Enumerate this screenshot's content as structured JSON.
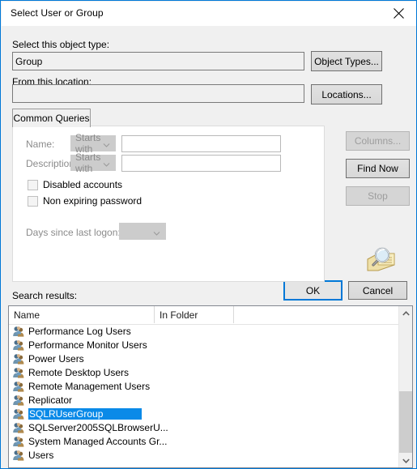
{
  "window": {
    "title": "Select User or Group",
    "close_icon": "close-icon"
  },
  "object_type": {
    "label": "Select this object type:",
    "value": "Group",
    "button": "Object Types..."
  },
  "location": {
    "label": "From this location:",
    "value": "",
    "button": "Locations..."
  },
  "tabs": [
    {
      "label": "Common Queries",
      "active": true
    }
  ],
  "query": {
    "name_label": "Name:",
    "name_operator": "Starts with",
    "name_value": "",
    "description_label": "Description:",
    "description_operator": "Starts with",
    "description_value": "",
    "disabled_accounts_label": "Disabled accounts",
    "disabled_accounts_checked": false,
    "non_expiring_password_label": "Non expiring password",
    "non_expiring_password_checked": false,
    "days_since_logon_label": "Days since last logon:",
    "days_since_logon_value": ""
  },
  "side_buttons": {
    "columns": "Columns...",
    "find_now": "Find Now",
    "stop": "Stop"
  },
  "decoration": {
    "magnifier_icon": "magnifier-folder-icon"
  },
  "dialog_buttons": {
    "ok": "OK",
    "cancel": "Cancel"
  },
  "results": {
    "label": "Search results:",
    "columns": [
      "Name",
      "In Folder"
    ],
    "rows": [
      {
        "name": "Performance Log Users",
        "folder": "",
        "selected": false
      },
      {
        "name": "Performance Monitor Users",
        "folder": "",
        "selected": false
      },
      {
        "name": "Power Users",
        "folder": "",
        "selected": false
      },
      {
        "name": "Remote Desktop Users",
        "folder": "",
        "selected": false
      },
      {
        "name": "Remote Management Users",
        "folder": "",
        "selected": false
      },
      {
        "name": "Replicator",
        "folder": "",
        "selected": false
      },
      {
        "name": "SQLRUserGroup",
        "folder": "",
        "selected": true
      },
      {
        "name": "SQLServer2005SQLBrowserU...",
        "folder": "",
        "selected": false
      },
      {
        "name": "System Managed Accounts Gr...",
        "folder": "",
        "selected": false
      },
      {
        "name": "Users",
        "folder": "",
        "selected": false
      }
    ]
  },
  "colors": {
    "accent": "#0078d7",
    "selection": "#0a8ae8",
    "dialog_bg": "#f0f0f0",
    "panel_bg": "#ffffff"
  }
}
